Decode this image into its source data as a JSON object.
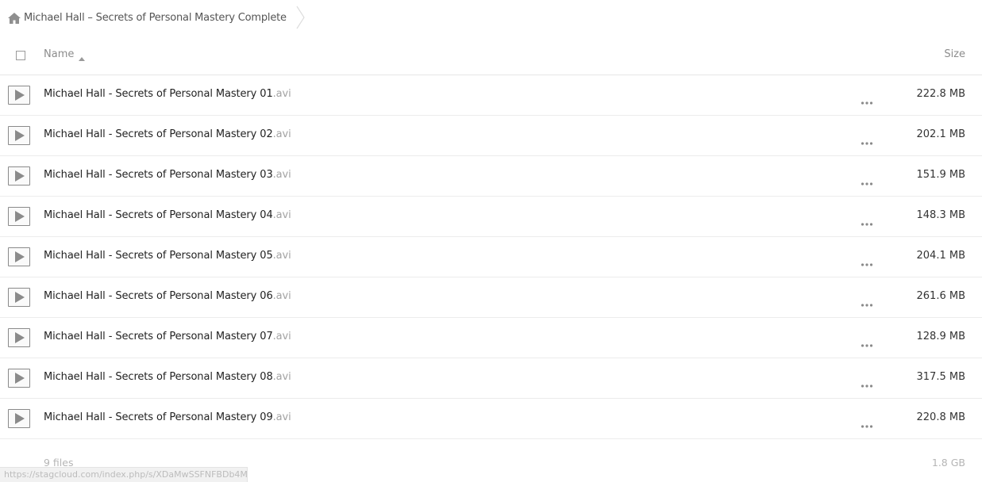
{
  "breadcrumb": {
    "home_icon": "home-icon",
    "folder": "Michael Hall – Secrets of Personal Mastery Complete"
  },
  "header": {
    "name": "Name",
    "size": "Size",
    "sort": "ascending"
  },
  "files": [
    {
      "base": "Michael Hall - Secrets of Personal Mastery 01",
      "ext": ".avi",
      "size": "222.8 MB"
    },
    {
      "base": "Michael Hall - Secrets of Personal Mastery 02",
      "ext": ".avi",
      "size": "202.1 MB"
    },
    {
      "base": "Michael Hall - Secrets of Personal Mastery 03",
      "ext": ".avi",
      "size": "151.9 MB"
    },
    {
      "base": "Michael Hall - Secrets of Personal Mastery 04",
      "ext": ".avi",
      "size": "148.3 MB"
    },
    {
      "base": "Michael Hall - Secrets of Personal Mastery 05",
      "ext": ".avi",
      "size": "204.1 MB"
    },
    {
      "base": "Michael Hall - Secrets of Personal Mastery 06",
      "ext": ".avi",
      "size": "261.6 MB"
    },
    {
      "base": "Michael Hall - Secrets of Personal Mastery 07",
      "ext": ".avi",
      "size": "128.9 MB"
    },
    {
      "base": "Michael Hall - Secrets of Personal Mastery 08",
      "ext": ".avi",
      "size": "317.5 MB"
    },
    {
      "base": "Michael Hall - Secrets of Personal Mastery 09",
      "ext": ".avi",
      "size": "220.8 MB"
    }
  ],
  "summary": {
    "count": "9 files",
    "total_size": "1.8 GB"
  },
  "status_url": "https://stagcloud.com/index.php/s/XDaMwSSFNFBDb4M/(",
  "colors": {
    "text": "#222222",
    "muted": "#8c8c8c",
    "ext": "#a3a3a3",
    "divider": "#ececec"
  }
}
